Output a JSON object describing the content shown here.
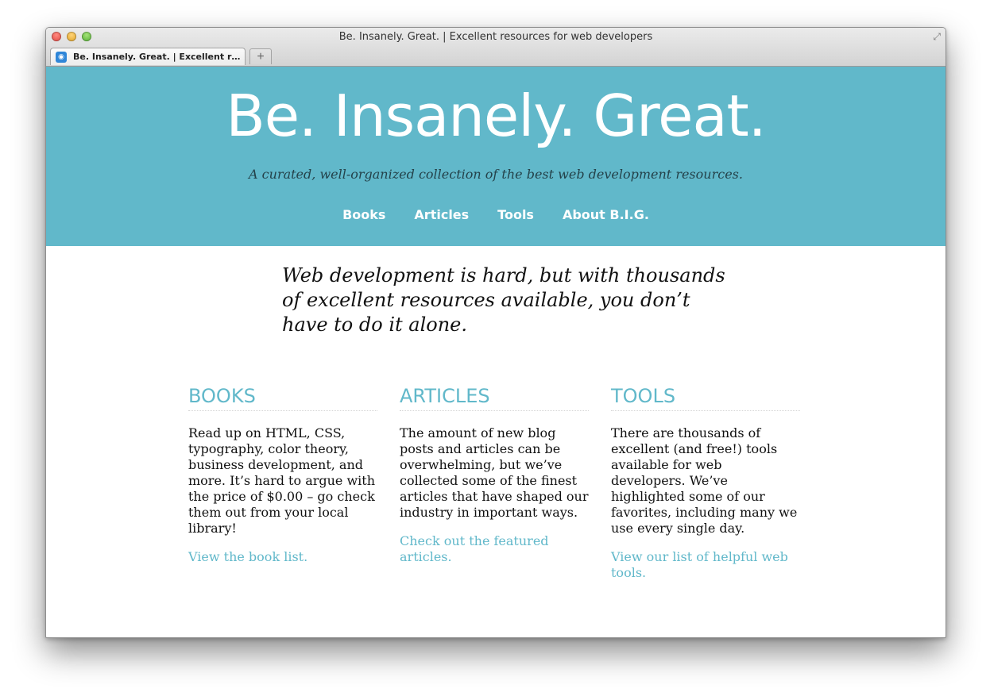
{
  "window": {
    "title": "Be. Insanely. Great. | Excellent resources for web developers"
  },
  "tab": {
    "label": "Be. Insanely. Great. | Excellent r…",
    "new_tab_symbol": "+"
  },
  "header": {
    "title": "Be. Insanely. Great.",
    "tagline": "A curated, well-organized collection of the best web development resources.",
    "background_color": "#61b8ca",
    "nav": [
      {
        "label": "Books"
      },
      {
        "label": "Articles"
      },
      {
        "label": "Tools"
      },
      {
        "label": "About B.I.G."
      }
    ]
  },
  "intro": "Web development is hard, but with thousands of excellent resources available, you don’t have to do it alone.",
  "sections": [
    {
      "heading": "BOOKS",
      "body": "Read up on HTML, CSS, typography, color theory, business development, and more. It’s hard to argue with the price of $0.00 – go check them out from your local library!",
      "link": "View the book list."
    },
    {
      "heading": "ARTICLES",
      "body": "The amount of new blog posts and articles can be overwhelming, but we’ve collected some of the finest articles that have shaped our industry in important ways.",
      "link": "Check out the featured articles."
    },
    {
      "heading": "TOOLS",
      "body": "There are thousands of excellent (and free!) tools available for web developers. We’ve highlighted some of our favorites, including many we use every single day.",
      "link": "View our list of helpful web tools."
    }
  ],
  "icons": {
    "close": "close-window-icon",
    "minimize": "minimize-window-icon",
    "zoom": "zoom-window-icon",
    "fullscreen": "fullscreen-icon",
    "favicon": "favicon-icon"
  }
}
